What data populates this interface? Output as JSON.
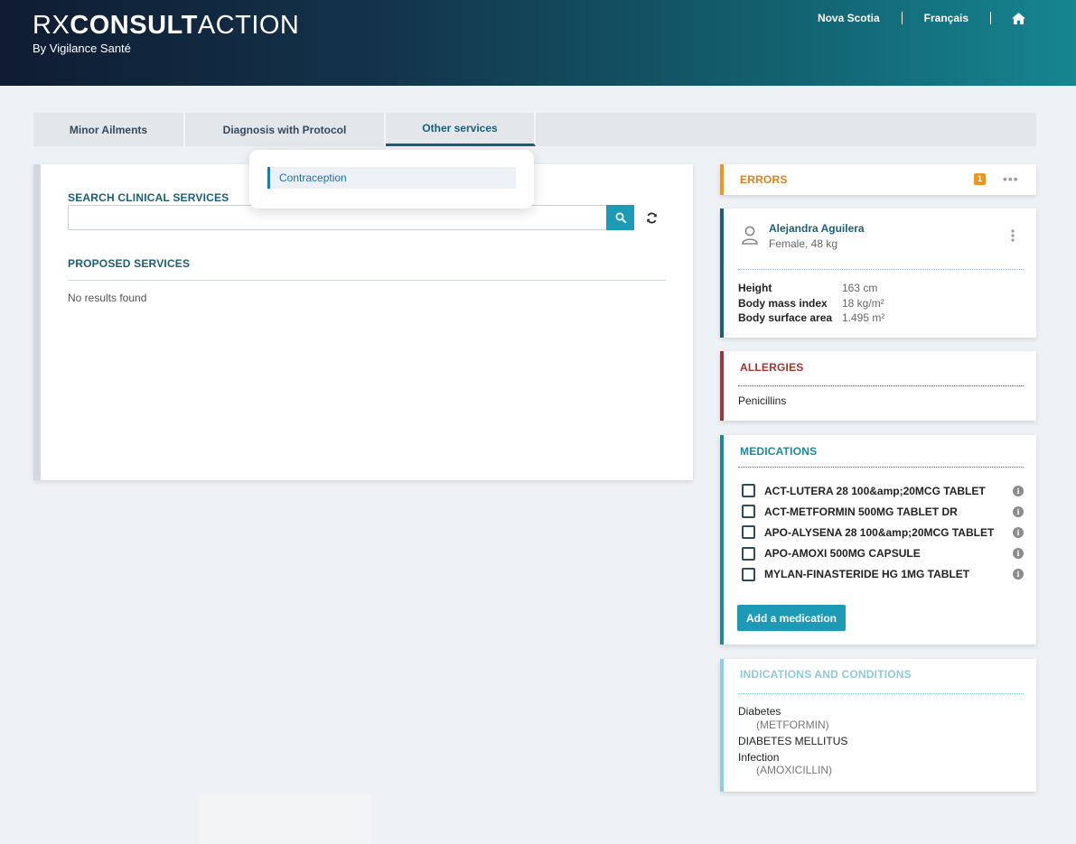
{
  "header": {
    "brand_rx": "RX",
    "brand_consult": "CONSULT",
    "brand_action": "ACTION",
    "subtitle": "By Vigilance Santé",
    "province": "Nova Scotia",
    "language": "Français",
    "home_icon": "home-icon"
  },
  "tabs": [
    {
      "label": "Minor Ailments"
    },
    {
      "label": "Diagnosis with Protocol"
    },
    {
      "label": "Other services"
    }
  ],
  "dropdown": {
    "items": [
      {
        "label": "Contraception"
      }
    ]
  },
  "search": {
    "label": "SEARCH CLINICAL SERVICES",
    "value": "",
    "placeholder": ""
  },
  "proposed": {
    "label": "PROPOSED SERVICES",
    "empty_text": "No results found"
  },
  "errors": {
    "title": "ERRORS",
    "count": "1"
  },
  "patient": {
    "name": "Alejandra Aguilera",
    "details": "Female, 48 kg",
    "metrics": [
      {
        "label": "Height",
        "value": "163 cm"
      },
      {
        "label": "Body mass index",
        "value": "18 kg/m²"
      },
      {
        "label": "Body surface area",
        "value": "1.495 m²"
      }
    ]
  },
  "allergies": {
    "title": "ALLERGIES",
    "items": [
      "Penicillins"
    ]
  },
  "medications": {
    "title": "MEDICATIONS",
    "items": [
      "ACT-LUTERA 28 100&amp;20MCG TABLET",
      "ACT-METFORMIN 500MG TABLET DR",
      "APO-ALYSENA 28 100&amp;20MCG TABLET",
      "APO-AMOXI 500MG CAPSULE",
      "MYLAN-FINASTERIDE HG 1MG TABLET"
    ],
    "add_label": "Add a medication"
  },
  "indications": {
    "title": "INDICATIONS AND CONDITIONS",
    "items": [
      {
        "name": "Diabetes",
        "drug": "(METFORMIN)"
      },
      {
        "name": "DIABETES MELLITUS",
        "drug": ""
      },
      {
        "name": "Infection",
        "drug": "(AMOXICILLIN)"
      }
    ]
  },
  "colors": {
    "brand_teal": "#1b5e77",
    "accent_blue": "#1c9ab6",
    "error_orange": "#f0941e",
    "allergy_red": "#a5332f",
    "indications_light": "#8ccfe0"
  }
}
